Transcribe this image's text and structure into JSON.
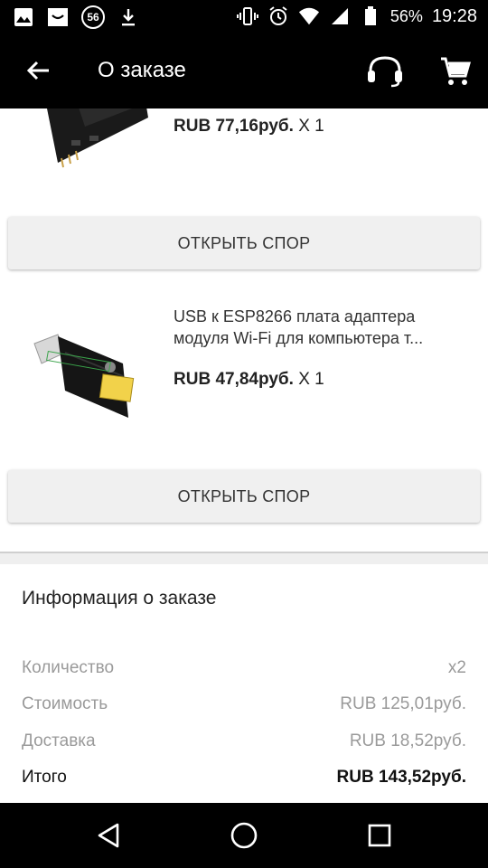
{
  "status_bar": {
    "icons_left": [
      "image-icon",
      "message-icon",
      "notification-badge",
      "download-icon"
    ],
    "badge_text": "56",
    "battery_percent": "56%",
    "time": "19:28"
  },
  "app_bar": {
    "title": "О заказе"
  },
  "products": [
    {
      "price": "RUB 77,16руб.",
      "qty": "X 1",
      "button": "ОТКРЫТЬ СПОР"
    },
    {
      "name": "USB к ESP8266 плата адаптера модуля Wi-Fi для компьютера т...",
      "price": "RUB 47,84руб.",
      "qty": "X 1",
      "button": "ОТКРЫТЬ СПОР"
    }
  ],
  "order_info": {
    "title": "Информация о заказе",
    "rows": [
      {
        "label": "Количество",
        "value": "x2"
      },
      {
        "label": "Стоимость",
        "value": "RUB 125,01руб."
      },
      {
        "label": "Доставка",
        "value": "RUB 18,52руб."
      },
      {
        "label": "Итого",
        "value": "RUB 143,52руб."
      }
    ]
  },
  "colors": {
    "bar_bg": "#000000",
    "button_bg": "#f0f0f0",
    "muted_text": "#9a9a9a"
  }
}
